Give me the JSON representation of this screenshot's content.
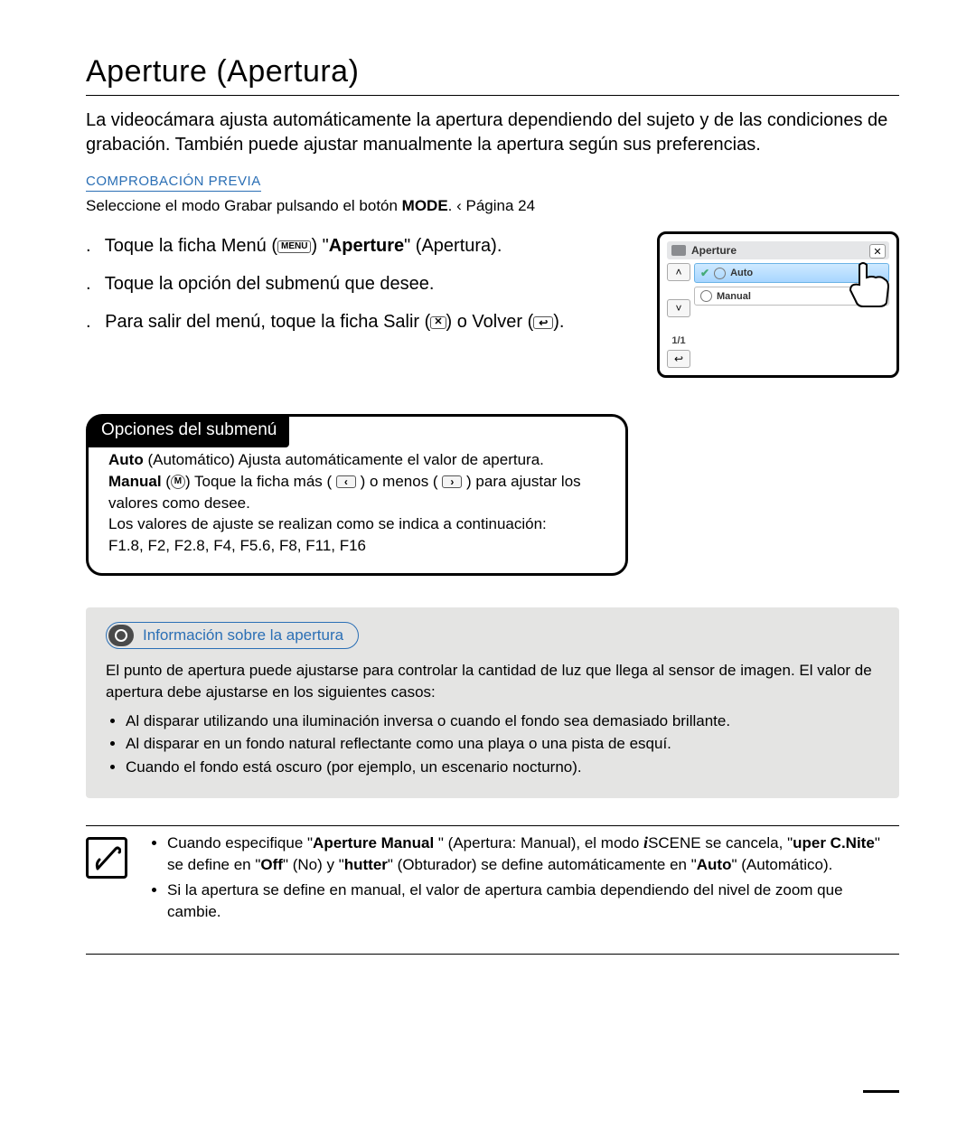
{
  "title": "Aperture (Apertura)",
  "intro": "La videocámara ajusta automáticamente la apertura dependiendo del sujeto y de las condiciones de grabación. También puede ajustar manualmente la apertura según sus preferencias.",
  "precheck": {
    "label": "COMPROBACIÓN PREVIA",
    "text_a": "Seleccione el modo Grabar pulsando el botón ",
    "text_b": "MODE",
    "text_c": ".  ‹ Página 24"
  },
  "steps": {
    "s1a": "Toque la ficha Menú (",
    "s1b": ")      \"",
    "s1c": "Aperture",
    "s1d": "\" (Apertura).",
    "s2": "Toque la opción del submenú que desee.",
    "s3a": "Para salir del menú, toque la ficha Salir (",
    "s3b": ") o Volver (",
    "s3c": ")."
  },
  "icons": {
    "menu": "MENU",
    "close": "✕",
    "back": "↩",
    "left": "‹",
    "right": "›",
    "up": "˄",
    "down": "˅",
    "manual": "M"
  },
  "screen": {
    "title": "Aperture",
    "option1": "Auto",
    "option2": "Manual",
    "page": "1/1"
  },
  "submenu": {
    "heading": "Opciones del submenú",
    "auto_b": "Auto",
    "auto_t": " (Automático) Ajusta automáticamente el valor de apertura.",
    "manual_b": "Manual",
    "manual_t1": " (",
    "manual_t2": ") Toque la ficha más ( ",
    "manual_t3": " ) o menos ( ",
    "manual_t4": " ) para ajustar los valores como desee.",
    "line3": "Los valores de ajuste se realizan como se indica a continuación:",
    "line4": "F1.8, F2, F2.8, F4, F5.6, F8, F11, F16"
  },
  "info": {
    "pill": "Información sobre la apertura",
    "p1": "El punto de apertura puede ajustarse para controlar la cantidad de luz que llega al sensor de imagen. El valor de apertura debe ajustarse en los siguientes casos:",
    "b1": "Al disparar utilizando una iluminación inversa o cuando el fondo sea demasiado brillante.",
    "b2": "Al disparar en un fondo natural reflectante como una playa o una pista de esquí.",
    "b3": "Cuando el fondo está oscuro (por ejemplo, un escenario nocturno)."
  },
  "note": {
    "n1a": "Cuando especifique \"",
    "n1b": "Aperture Manual",
    "n1c": "  \" (Apertura: Manual), el modo ",
    "n1d": "SCENE se cancela, \"",
    "n1e": "uper C.Nite",
    "n1f": "\" se define en \"",
    "n1g": "Off",
    "n1h": "\" (No) y \"",
    "n1i": "hutter",
    "n1j": "\" (Obturador) se define automáticamente en \"",
    "n1k": "Auto",
    "n1l": "\" (Automático).",
    "n2": "Si la apertura se define en manual, el valor de apertura cambia dependiendo del nivel de zoom que cambie."
  }
}
